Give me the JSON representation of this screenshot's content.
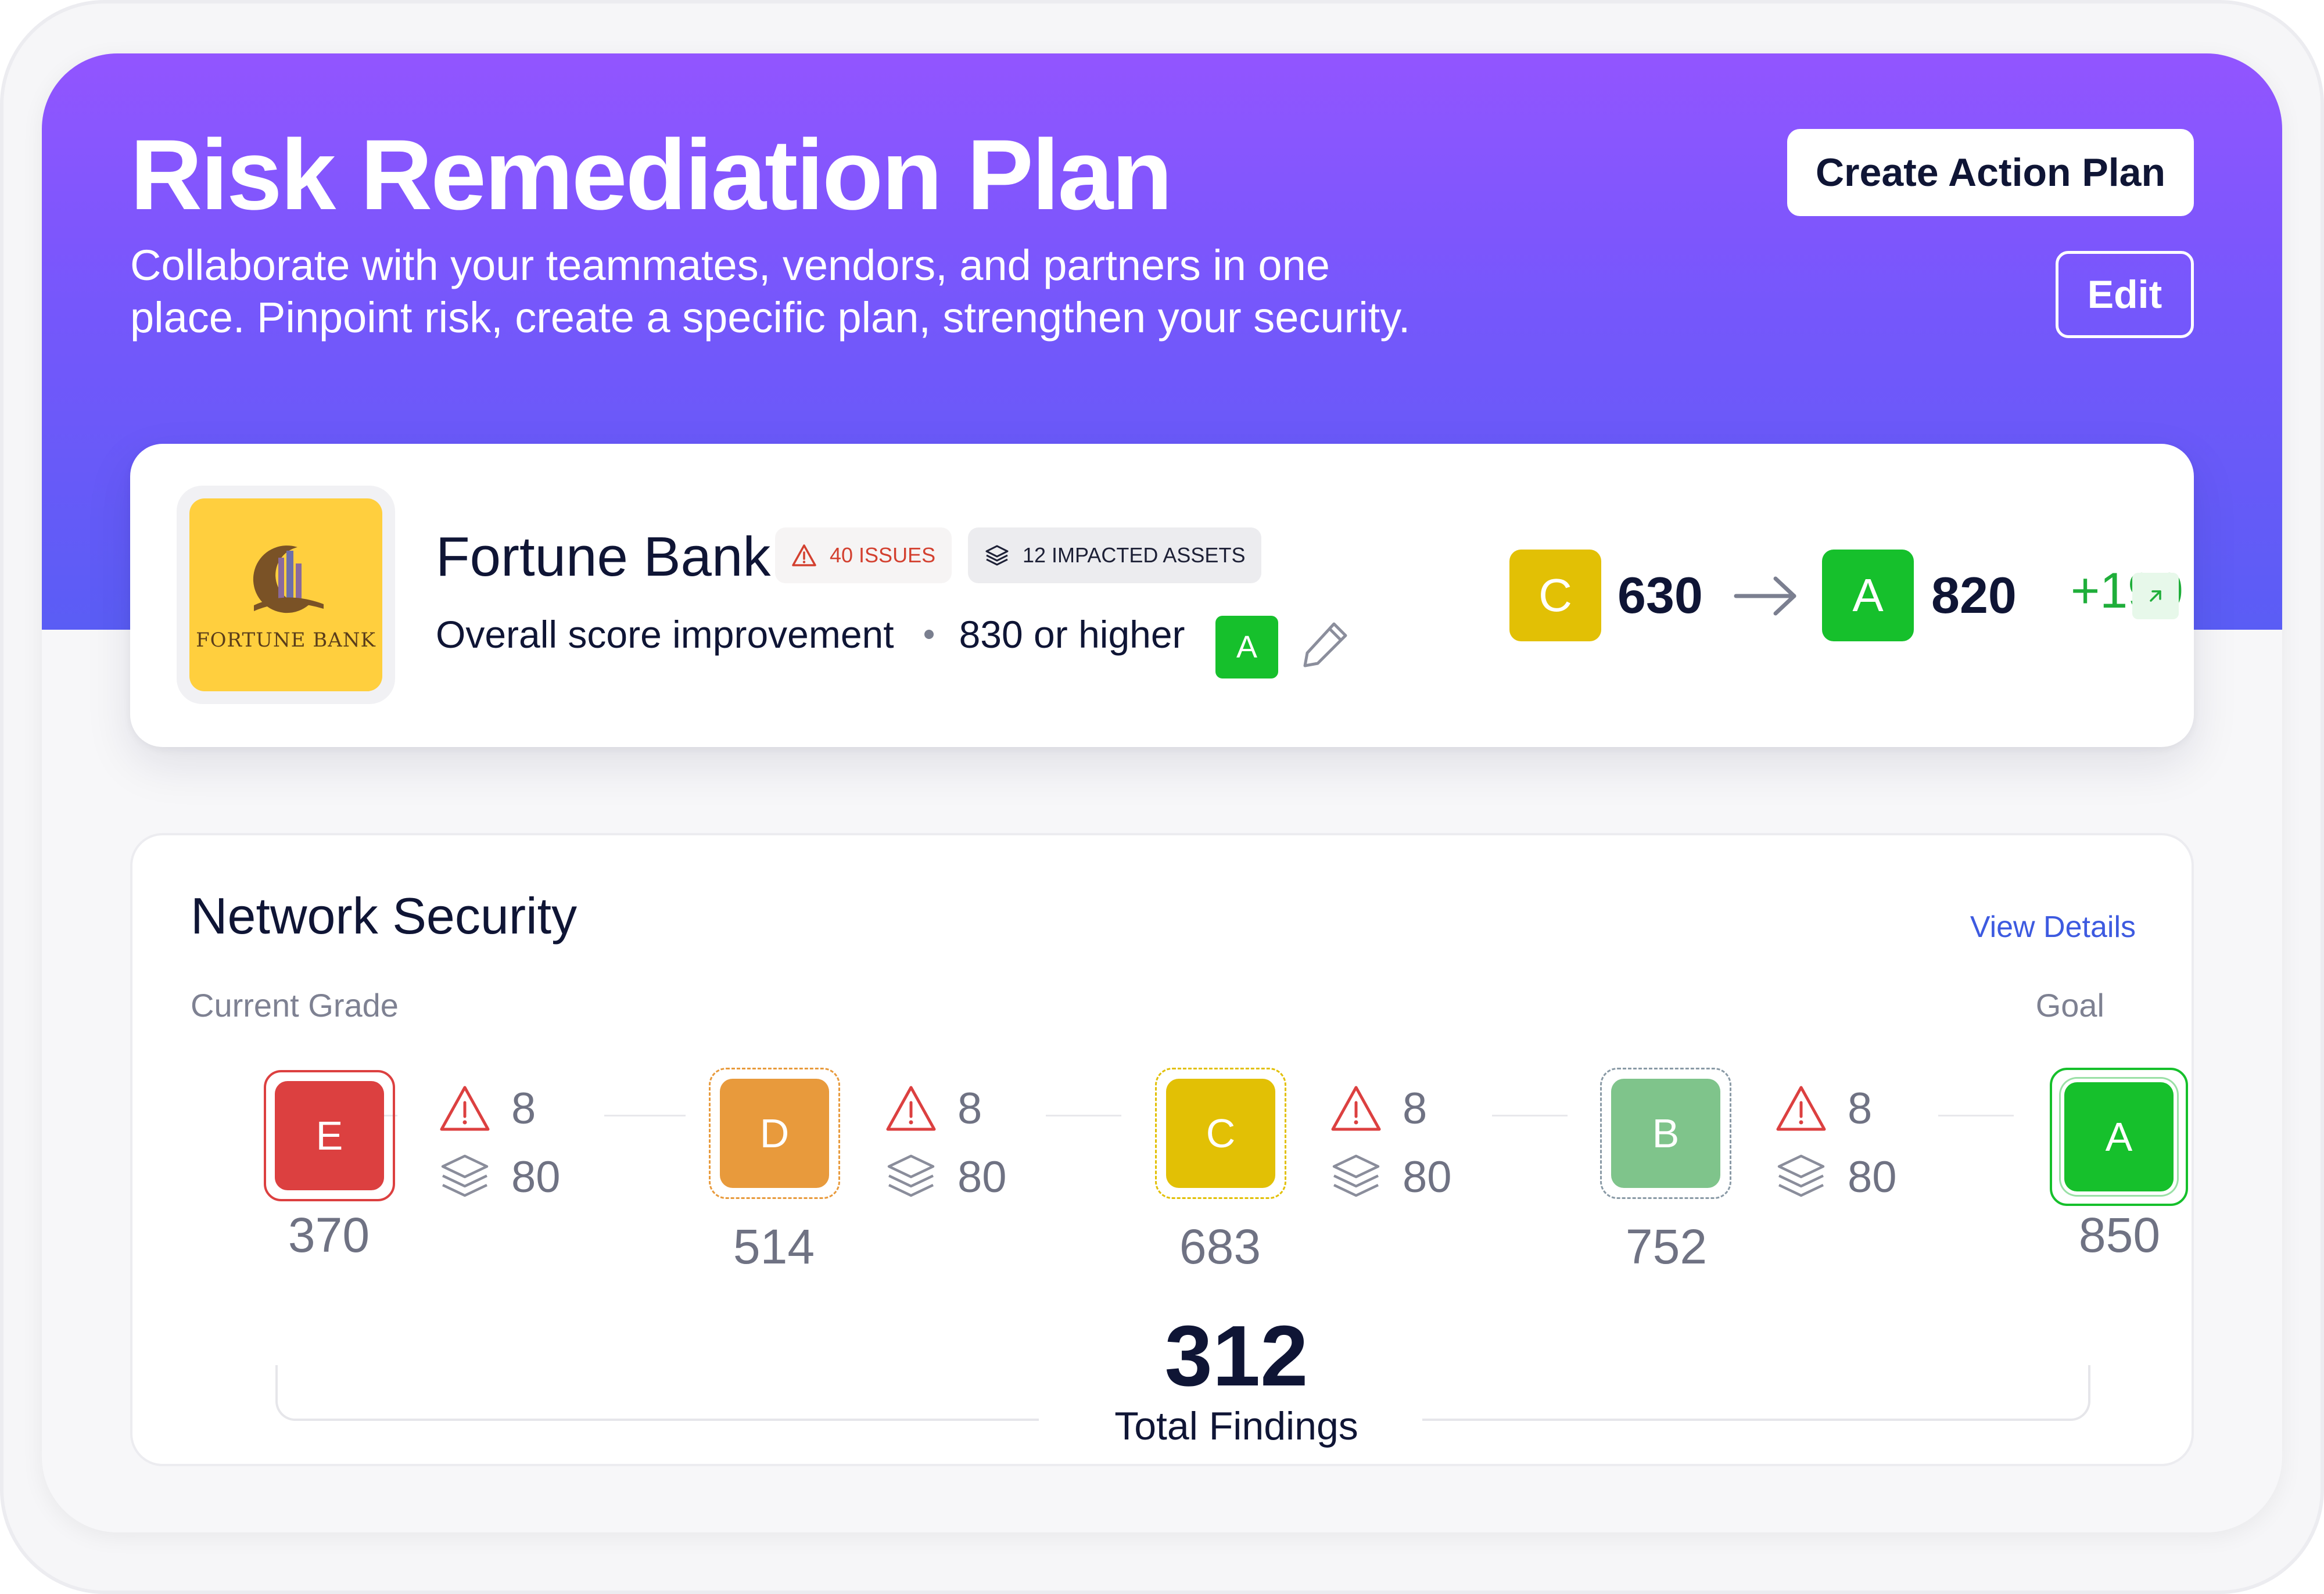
{
  "header": {
    "title": "Risk Remediation Plan",
    "subtitle_line1": "Collaborate with your teammates, vendors, and partners in one",
    "subtitle_line2": "place. Pinpoint risk, create a specific plan, strengthen your security.",
    "create_action_plan_label": "Create Action Plan",
    "edit_label": "Edit"
  },
  "company": {
    "logo_text": "FORTUNE BANK",
    "name": "Fortune Bank",
    "issues_badge": "40 ISSUES",
    "assets_badge": "12 IMPACTED ASSETS",
    "improvement_label": "Overall score improvement",
    "target_label": "830 or higher",
    "target_grade": "A",
    "current_grade": "C",
    "current_score": "630",
    "projected_grade": "A",
    "projected_score": "820",
    "delta": "+190"
  },
  "network": {
    "title": "Network Security",
    "view_details_label": "View Details",
    "current_grade_label": "Current Grade",
    "goal_label": "Goal",
    "grades": [
      {
        "grade": "E",
        "score": "370",
        "color": "#dc4040"
      },
      {
        "grade": "D",
        "score": "514",
        "color": "#e89a3c"
      },
      {
        "grade": "C",
        "score": "683",
        "color": "#e2c005"
      },
      {
        "grade": "B",
        "score": "752",
        "color": "#7fc48b"
      },
      {
        "grade": "A",
        "score": "850",
        "color": "#16c02c"
      }
    ],
    "steps": [
      {
        "issues": "8",
        "assets": "80"
      },
      {
        "issues": "8",
        "assets": "80"
      },
      {
        "issues": "8",
        "assets": "80"
      },
      {
        "issues": "8",
        "assets": "80"
      }
    ],
    "total_findings": "312",
    "total_findings_label": "Total Findings"
  }
}
